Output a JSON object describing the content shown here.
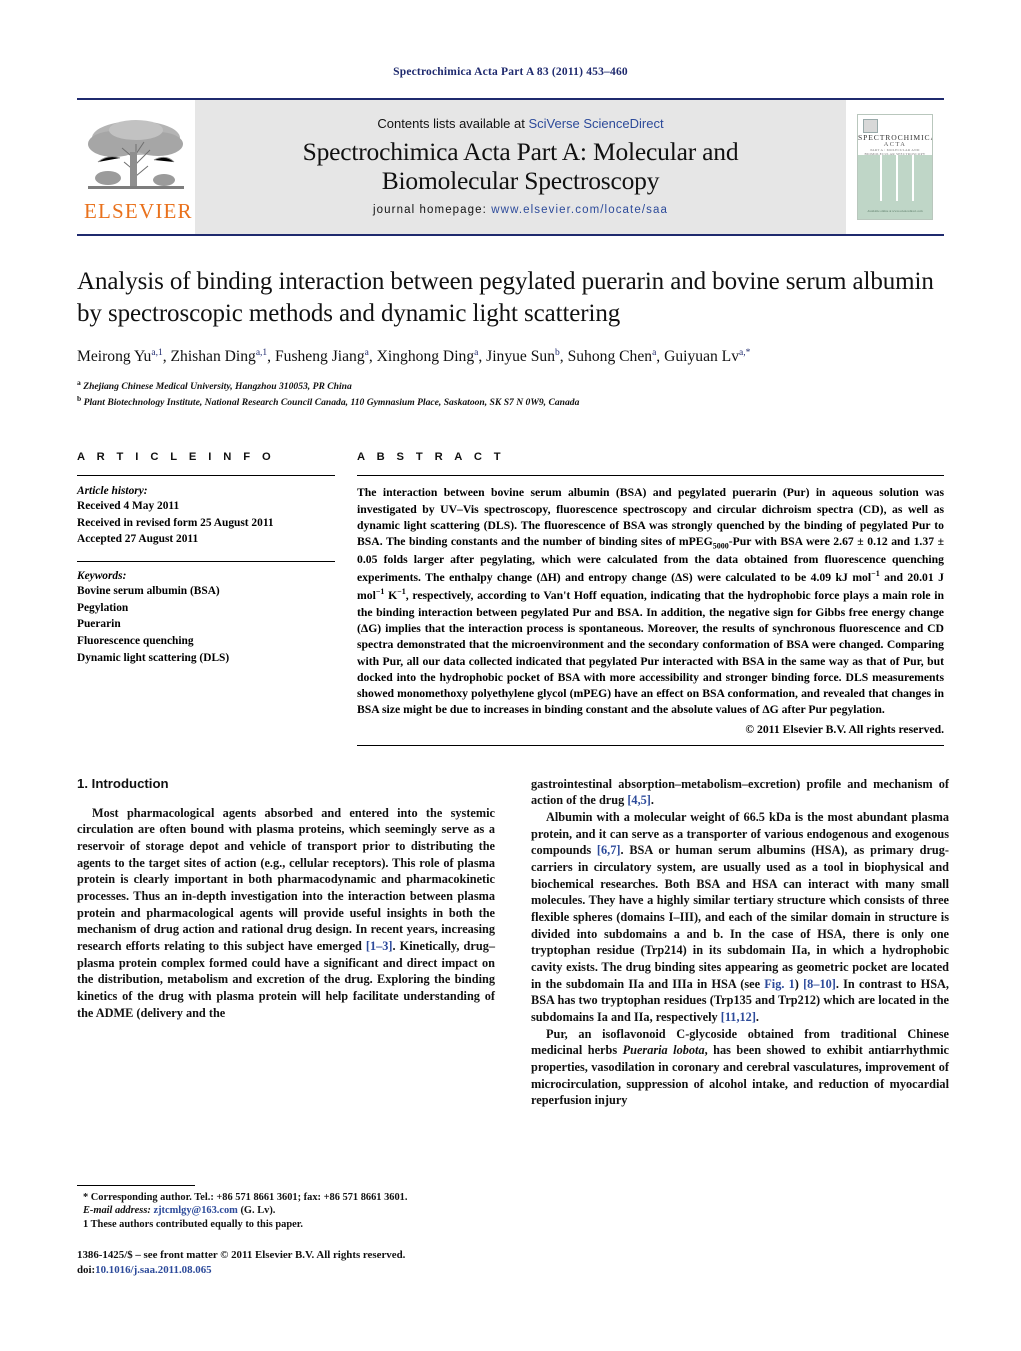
{
  "running_head": "Spectrochimica Acta Part A 83 (2011) 453–460",
  "masthead": {
    "contents_prefix": "Contents lists available at ",
    "contents_link": "SciVerse ScienceDirect",
    "journal_title_line1": "Spectrochimica Acta Part A: Molecular and",
    "journal_title_line2": "Biomolecular Spectroscopy",
    "homepage_label": "journal homepage: ",
    "homepage_url": "www.elsevier.com/locate/saa",
    "publisher_wordmark": "ELSEVIER",
    "cover": {
      "line1": "SPECTROCHIMICA",
      "line2": "ACTA",
      "line3": "PART A : MOLECULAR AND BIOMOLECULAR SPECTROSCOPY",
      "footer": "Available online at www.sciencedirect.com"
    }
  },
  "article": {
    "title": "Analysis of binding interaction between pegylated puerarin and bovine serum albumin by spectroscopic methods and dynamic light scattering",
    "authors": [
      {
        "name": "Meirong Yu",
        "marks": "a,1",
        "sep": ", "
      },
      {
        "name": "Zhishan Ding",
        "marks": "a,1",
        "sep": ", "
      },
      {
        "name": "Fusheng Jiang",
        "marks": "a",
        "sep": ", "
      },
      {
        "name": "Xinghong Ding",
        "marks": "a",
        "sep": ", "
      },
      {
        "name": "Jinyue Sun",
        "marks": "b",
        "sep": ", "
      },
      {
        "name": "Suhong Chen",
        "marks": "a",
        "sep": ", "
      },
      {
        "name": "Guiyuan Lv",
        "marks": "a,*",
        "sep": ""
      }
    ],
    "affiliations": [
      {
        "mark": "a",
        "text": "Zhejiang Chinese Medical University, Hangzhou 310053, PR China"
      },
      {
        "mark": "b",
        "text": "Plant Biotechnology Institute, National Research Council Canada, 110 Gymnasium Place, Saskatoon, SK S7 N 0W9, Canada"
      }
    ]
  },
  "article_info": {
    "heading": "A R T I C L E   I N F O",
    "history_label": "Article history:",
    "history": [
      "Received 4 May 2011",
      "Received in revised form 25 August 2011",
      "Accepted 27 August 2011"
    ],
    "keywords_label": "Keywords:",
    "keywords": [
      "Bovine serum albumin (BSA)",
      "Pegylation",
      "Puerarin",
      "Fluorescence quenching",
      "Dynamic light scattering (DLS)"
    ]
  },
  "abstract": {
    "heading": "A B S T R A C T",
    "part1": "The interaction between bovine serum albumin (BSA) and pegylated puerarin (Pur) in aqueous solution was investigated by UV–Vis spectroscopy, fluorescence spectroscopy and circular dichroism spectra (CD), as well as dynamic light scattering (DLS). The fluorescence of BSA was strongly quenched by the binding of pegylated Pur to BSA. The binding constants and the number of binding sites of mPEG",
    "peg_sub": "5000",
    "part2": "-Pur with BSA were 2.67 ± 0.12 and 1.37 ± 0.05 folds larger after pegylating, which were calculated from the data obtained from fluorescence quenching experiments. The enthalpy change (ΔH) and entropy change (ΔS) were calculated to be 4.09 kJ mol",
    "exp1": "−1",
    "part3": " and 20.01 J mol",
    "exp2": "−1",
    "part4": " K",
    "exp3": "−1",
    "part5": ", respectively, according to Van't Hoff equation, indicating that the hydrophobic force plays a main role in the binding interaction between pegylated Pur and BSA. In addition, the negative sign for Gibbs free energy change (ΔG) implies that the interaction process is spontaneous. Moreover, the results of synchronous fluorescence and CD spectra demonstrated that the microenvironment and the secondary conformation of BSA were changed. Comparing with Pur, all our data collected indicated that pegylated Pur interacted with BSA in the same way as that of Pur, but docked into the hydrophobic pocket of BSA with more accessibility and stronger binding force. DLS measurements showed monomethoxy polyethylene glycol (mPEG) have an effect on BSA conformation, and revealed that changes in BSA size might be due to increases in binding constant and the absolute values of ΔG after Pur pegylation.",
    "copyright": "© 2011 Elsevier B.V. All rights reserved."
  },
  "introduction": {
    "heading": "1.  Introduction",
    "left_p1_a": "Most pharmacological agents absorbed and entered into the systemic circulation are often bound with plasma proteins, which seemingly serve as a reservoir of storage depot and vehicle of transport prior to distributing the agents to the target sites of action (e.g., cellular receptors). This role of plasma protein is clearly important in both pharmacodynamic and pharmacokinetic processes. Thus an in-depth investigation into the interaction between plasma protein and pharmacological agents will provide useful insights in both the mechanism of drug action and rational drug design. In recent years, increasing research efforts relating to this subject have emerged ",
    "left_ref1": "[1–3]",
    "left_p1_b": ". Kinetically, drug–plasma protein complex formed could have a significant and direct impact on the distribution, metabolism and excretion of the drug. Exploring the binding kinetics of the drug with plasma protein will help facilitate understanding of the ADME (delivery and the",
    "right_p1_a": "gastrointestinal absorption–metabolism–excretion) profile and mechanism of action of the drug ",
    "right_ref1": "[4,5]",
    "right_p1_b": ".",
    "right_p2_a": "Albumin with a molecular weight of 66.5 kDa is the most abundant plasma protein, and it can serve as a transporter of various endogenous and exogenous compounds ",
    "right_ref2": "[6,7]",
    "right_p2_b": ". BSA or human serum albumins (HSA), as primary drug-carriers in circulatory system, are usually used as a tool in biophysical and biochemical researches. Both BSA and HSA can interact with many small molecules. They have a highly similar tertiary structure which consists of three flexible spheres (domains I–III), and each of the similar domain in structure is divided into subdomains a and b. In the case of HSA, there is only one tryptophan residue (Trp214) in its subdomain IIa, in which a hydrophobic cavity exists. The drug binding sites appearing as geometric pocket are located in the subdomain IIa and IIIa in HSA (see ",
    "right_figref": "Fig. 1",
    "right_p2_c": ") ",
    "right_ref3": "[8–10]",
    "right_p2_d": ". In contrast to HSA, BSA has two tryptophan residues (Trp135 and Trp212) which are located in the subdomains Ia and IIa, respectively ",
    "right_ref4": "[11,12]",
    "right_p2_e": ".",
    "right_p3_a": "Pur, an isoflavonoid C-glycoside obtained from traditional Chinese medicinal herbs ",
    "right_italic": "Pueraria lobota",
    "right_p3_b": ", has been showed to exhibit antiarrhythmic properties, vasodilation in coronary and cerebral vasculatures, improvement of microcirculation, suppression of alcohol intake, and reduction of myocardial reperfusion injury"
  },
  "footnotes": {
    "corresponding": "* Corresponding author. Tel.: +86 571 8661 3601; fax: +86 571 8661 3601.",
    "email_label": "E-mail address:",
    "email": "zjtcmlgy@163.com",
    "email_suffix": "(G. Lv).",
    "equal_contrib": "1  These authors contributed equally to this paper.",
    "issn_line": "1386-1425/$ – see front matter © 2011 Elsevier B.V. All rights reserved.",
    "doi_label": "doi:",
    "doi": "10.1016/j.saa.2011.08.065"
  },
  "colors": {
    "rule_blue": "#1f2a6e",
    "link_blue": "#2c4a9a",
    "elsevier_orange": "#E9711C",
    "masthead_gray": "#e6e6e6",
    "cover_green": "#bfd6c7"
  }
}
